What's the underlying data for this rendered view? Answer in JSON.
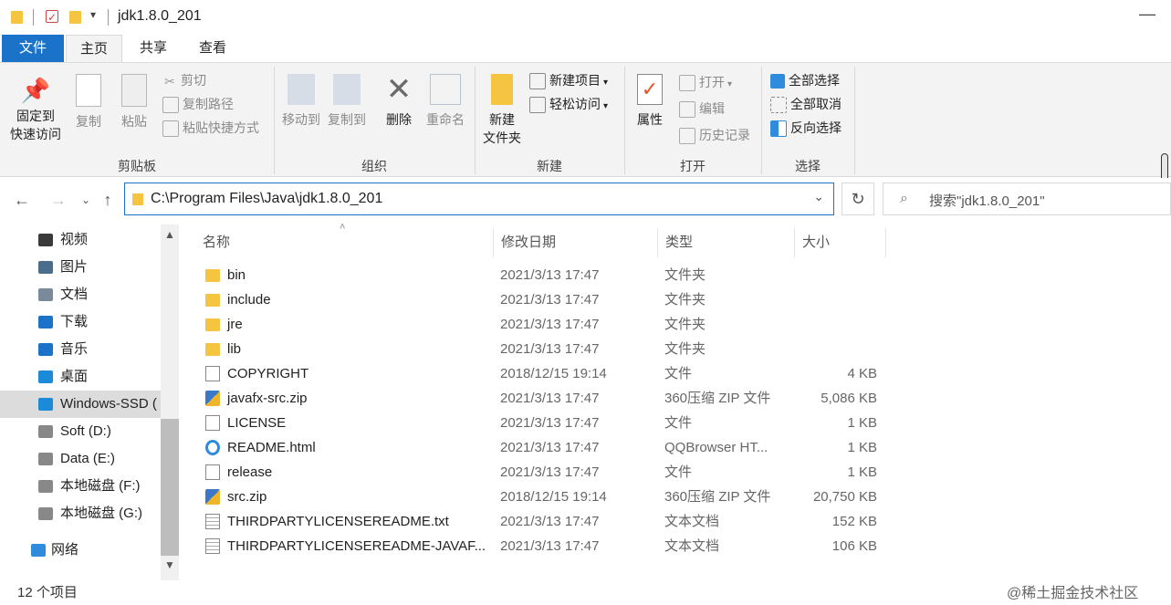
{
  "window": {
    "title": "jdk1.8.0_201",
    "minimize_glyph": "—"
  },
  "tabs": [
    "文件",
    "主页",
    "共享",
    "查看"
  ],
  "ribbon": {
    "clipboard": {
      "label": "剪贴板",
      "pin_line1": "固定到",
      "pin_line2": "快速访问",
      "copy": "复制",
      "paste": "粘贴",
      "cut": "剪切",
      "copy_path": "复制路径",
      "paste_shortcut": "粘贴快捷方式"
    },
    "organize": {
      "label": "组织",
      "move_to": "移动到",
      "copy_to": "复制到",
      "delete": "删除",
      "rename": "重命名"
    },
    "new": {
      "label": "新建",
      "new_folder_line1": "新建",
      "new_folder_line2": "文件夹",
      "new_item": "新建项目",
      "easy_access": "轻松访问"
    },
    "open": {
      "label": "打开",
      "properties": "属性",
      "open": "打开",
      "edit": "编辑",
      "history": "历史记录"
    },
    "select": {
      "label": "选择",
      "select_all": "全部选择",
      "select_none": "全部取消",
      "invert": "反向选择"
    }
  },
  "address": {
    "path": "C:\\Program Files\\Java\\jdk1.8.0_201",
    "search_placeholder": "搜索\"jdk1.8.0_201\""
  },
  "nav_pane": {
    "items": [
      {
        "label": "视频",
        "icon": "video-icon",
        "color": "#3a3a3a"
      },
      {
        "label": "图片",
        "icon": "pictures-icon",
        "color": "#4a6d8c"
      },
      {
        "label": "文档",
        "icon": "documents-icon",
        "color": "#7a8a9a"
      },
      {
        "label": "下载",
        "icon": "download-icon",
        "color": "#1a73c9"
      },
      {
        "label": "音乐",
        "icon": "music-icon",
        "color": "#1a73c9"
      },
      {
        "label": "桌面",
        "icon": "desktop-icon",
        "color": "#1a8ad9"
      },
      {
        "label": "Windows-SSD (",
        "icon": "windows-drive-icon",
        "color": "#1a8ad9"
      },
      {
        "label": "Soft (D:)",
        "icon": "drive-icon",
        "color": "#888888"
      },
      {
        "label": "Data (E:)",
        "icon": "drive-icon",
        "color": "#888888"
      },
      {
        "label": "本地磁盘 (F:)",
        "icon": "drive-icon",
        "color": "#888888"
      },
      {
        "label": "本地磁盘 (G:)",
        "icon": "drive-icon",
        "color": "#888888"
      },
      {
        "label": "网络",
        "icon": "network-icon",
        "color": "#2f8cdd"
      }
    ]
  },
  "columns": [
    "名称",
    "修改日期",
    "类型",
    "大小"
  ],
  "files": [
    {
      "name": "bin",
      "date": "2021/3/13 17:47",
      "type": "文件夹",
      "size": "",
      "icon": "folder"
    },
    {
      "name": "include",
      "date": "2021/3/13 17:47",
      "type": "文件夹",
      "size": "",
      "icon": "folder"
    },
    {
      "name": "jre",
      "date": "2021/3/13 17:47",
      "type": "文件夹",
      "size": "",
      "icon": "folder"
    },
    {
      "name": "lib",
      "date": "2021/3/13 17:47",
      "type": "文件夹",
      "size": "",
      "icon": "folder"
    },
    {
      "name": "COPYRIGHT",
      "date": "2018/12/15 19:14",
      "type": "文件",
      "size": "4 KB",
      "icon": "file"
    },
    {
      "name": "javafx-src.zip",
      "date": "2021/3/13 17:47",
      "type": "360压缩 ZIP 文件",
      "size": "5,086 KB",
      "icon": "zip"
    },
    {
      "name": "LICENSE",
      "date": "2021/3/13 17:47",
      "type": "文件",
      "size": "1 KB",
      "icon": "file"
    },
    {
      "name": "README.html",
      "date": "2021/3/13 17:47",
      "type": "QQBrowser HT...",
      "size": "1 KB",
      "icon": "html"
    },
    {
      "name": "release",
      "date": "2021/3/13 17:47",
      "type": "文件",
      "size": "1 KB",
      "icon": "file"
    },
    {
      "name": "src.zip",
      "date": "2018/12/15 19:14",
      "type": "360压缩 ZIP 文件",
      "size": "20,750 KB",
      "icon": "zip"
    },
    {
      "name": "THIRDPARTYLICENSEREADME.txt",
      "date": "2021/3/13 17:47",
      "type": "文本文档",
      "size": "152 KB",
      "icon": "txt"
    },
    {
      "name": "THIRDPARTYLICENSEREADME-JAVAF...",
      "date": "2021/3/13 17:47",
      "type": "文本文档",
      "size": "106 KB",
      "icon": "txt"
    }
  ],
  "status": {
    "count": "12 个项目",
    "watermark": "@稀土掘金技术社区"
  },
  "colors": {
    "accent": "#1a73c9",
    "folder": "#f5c542",
    "ribbon_bg": "#f3f3f3"
  }
}
